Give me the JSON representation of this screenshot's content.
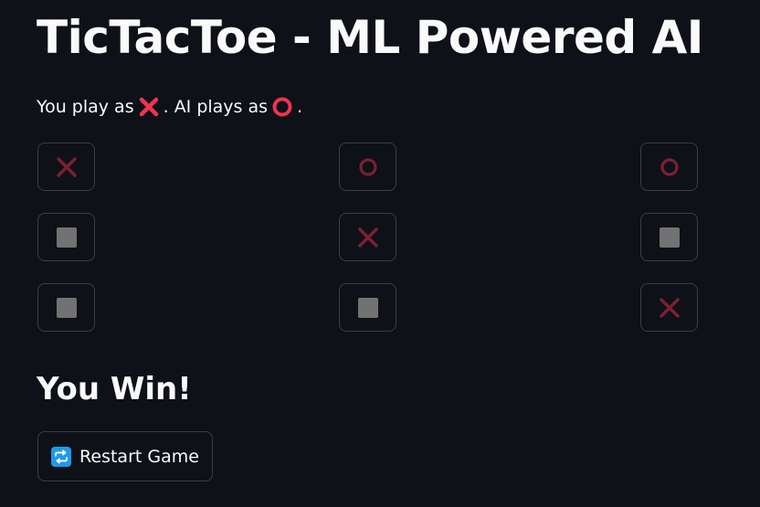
{
  "header": {
    "title": "TicTacToe - ML Powered AI"
  },
  "intro": {
    "you_play": "You play as",
    "player_mark_icon": "cross-mark-emoji",
    "ai_plays": ". AI plays as",
    "ai_mark_icon": "hollow-circle-emoji",
    "end": "."
  },
  "board": {
    "rows": [
      [
        "X",
        "O",
        "O"
      ],
      [
        "empty",
        "X",
        "empty"
      ],
      [
        "empty",
        "empty",
        "X"
      ]
    ],
    "colors": {
      "x_mark": "#7d1f33",
      "o_mark": "#7d1f33",
      "empty_mark": "#727272",
      "emoji_red": "#f0334f"
    }
  },
  "status": {
    "result": "You Win!"
  },
  "controls": {
    "restart_icon": "repeat-arrows-icon",
    "restart_label": "Restart Game",
    "restart_icon_color": "#1e9be9"
  }
}
